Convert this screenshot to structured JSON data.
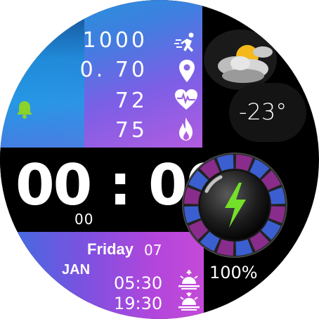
{
  "stats": {
    "steps": "1000",
    "distance": "0. 70",
    "heart_rate": "72",
    "calories": "75"
  },
  "icons": {
    "steps": "running-person-icon",
    "distance": "location-pin-icon",
    "heart_rate": "heart-pulse-icon",
    "calories": "flame-icon",
    "alarm": "bell-icon",
    "weather": "partly-cloudy-icon",
    "battery": "lightning-bolt-icon",
    "sunrise": "sunrise-icon",
    "sunset": "sunset-icon"
  },
  "weather": {
    "temperature": "-23°"
  },
  "time": {
    "hours_minutes": "00 : 00",
    "seconds": "00"
  },
  "date": {
    "day": "Friday",
    "day_num": "07",
    "month": "JAN"
  },
  "sun": {
    "sunrise": "05:30",
    "sunset": "19:30"
  },
  "battery": {
    "percent": "100%"
  },
  "colors": {
    "accent_green": "#74e02a",
    "bell_green": "#8bd22a",
    "ring_purple": "#8a2c8c",
    "ring_blue": "#3b5fd0"
  }
}
